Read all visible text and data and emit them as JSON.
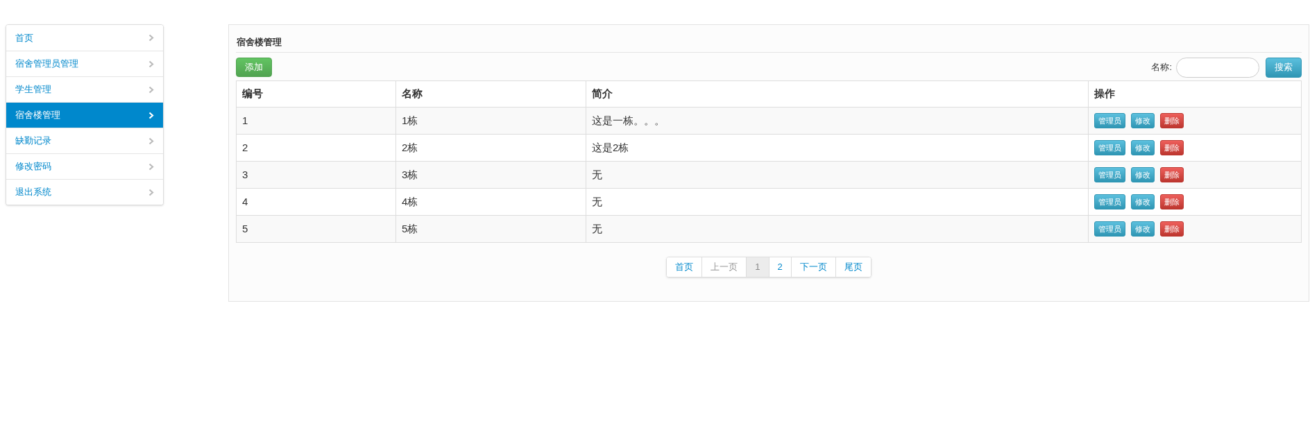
{
  "sidebar": {
    "items": [
      {
        "label": "首页",
        "selected": false
      },
      {
        "label": "宿舍管理员管理",
        "selected": false
      },
      {
        "label": "学生管理",
        "selected": false
      },
      {
        "label": "宿舍楼管理",
        "selected": true
      },
      {
        "label": "缺勤记录",
        "selected": false
      },
      {
        "label": "修改密码",
        "selected": false
      },
      {
        "label": "退出系统",
        "selected": false
      }
    ]
  },
  "panel": {
    "title": "宿舍楼管理",
    "add_button": "添加",
    "search": {
      "label": "名称:",
      "button": "搜索"
    }
  },
  "table": {
    "columns": [
      "编号",
      "名称",
      "简介",
      "操作"
    ],
    "rows": [
      {
        "cells": [
          "1",
          "1栋",
          "这是一栋。。。"
        ],
        "actions": [
          "管理员",
          "修改",
          "删除"
        ]
      },
      {
        "cells": [
          "2",
          "2栋",
          "这是2栋"
        ],
        "actions": [
          "管理员",
          "修改",
          "删除"
        ]
      },
      {
        "cells": [
          "3",
          "3栋",
          "无"
        ],
        "actions": [
          "管理员",
          "修改",
          "删除"
        ]
      },
      {
        "cells": [
          "4",
          "4栋",
          "无"
        ],
        "actions": [
          "管理员",
          "修改",
          "删除"
        ]
      },
      {
        "cells": [
          "5",
          "5栋",
          "无"
        ],
        "actions": [
          "管理员",
          "修改",
          "删除"
        ]
      }
    ]
  },
  "pagination": [
    {
      "label": "首页",
      "disabled": false,
      "selected": false
    },
    {
      "label": "上一页",
      "disabled": true,
      "selected": false
    },
    {
      "label": "1",
      "disabled": false,
      "selected": true
    },
    {
      "label": "2",
      "disabled": false,
      "selected": false
    },
    {
      "label": "下一页",
      "disabled": false,
      "selected": false
    },
    {
      "label": "尾页",
      "disabled": false,
      "selected": false
    }
  ]
}
